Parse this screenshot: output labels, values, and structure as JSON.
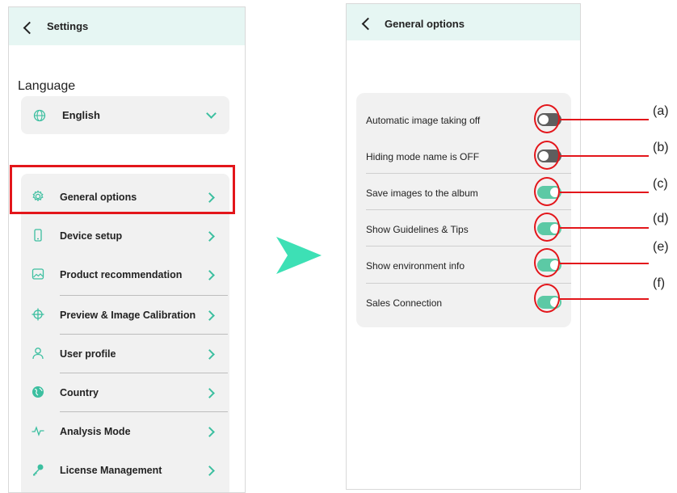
{
  "settings_screen": {
    "title": "Settings",
    "language_section": "Language",
    "language_value": "English",
    "menu": [
      {
        "label": "General options",
        "icon": "gear-icon"
      },
      {
        "label": "Device setup",
        "icon": "phone-icon"
      },
      {
        "label": "Product recommendation",
        "icon": "image-icon"
      },
      {
        "label": "Preview & Image Calibration",
        "icon": "crosshair-icon"
      },
      {
        "label": "User profile",
        "icon": "user-icon"
      },
      {
        "label": "Country",
        "icon": "globe-icon"
      },
      {
        "label": "Analysis Mode",
        "icon": "pulse-icon"
      },
      {
        "label": "License Management",
        "icon": "key-icon"
      }
    ]
  },
  "general_options_screen": {
    "title": "General options",
    "options": [
      {
        "label": "Automatic image taking off",
        "state": "off",
        "annotation": "(a)"
      },
      {
        "label": "Hiding mode name is OFF",
        "state": "off",
        "annotation": "(b)"
      },
      {
        "label": "Save images to the album",
        "state": "on",
        "annotation": "(c)"
      },
      {
        "label": "Show Guidelines & Tips",
        "state": "on",
        "annotation": "(d)"
      },
      {
        "label": "Show environment info",
        "state": "on",
        "annotation": "(e)"
      },
      {
        "label": "Sales Connection",
        "state": "on",
        "annotation": "(f)"
      }
    ]
  },
  "colors": {
    "header_bg": "#e6f6f3",
    "accent": "#3cbfa0",
    "toggle_on": "#5cc9a5",
    "toggle_off": "#5e5e5e",
    "highlight": "#e3161b",
    "arrow": "#3de0b5"
  }
}
